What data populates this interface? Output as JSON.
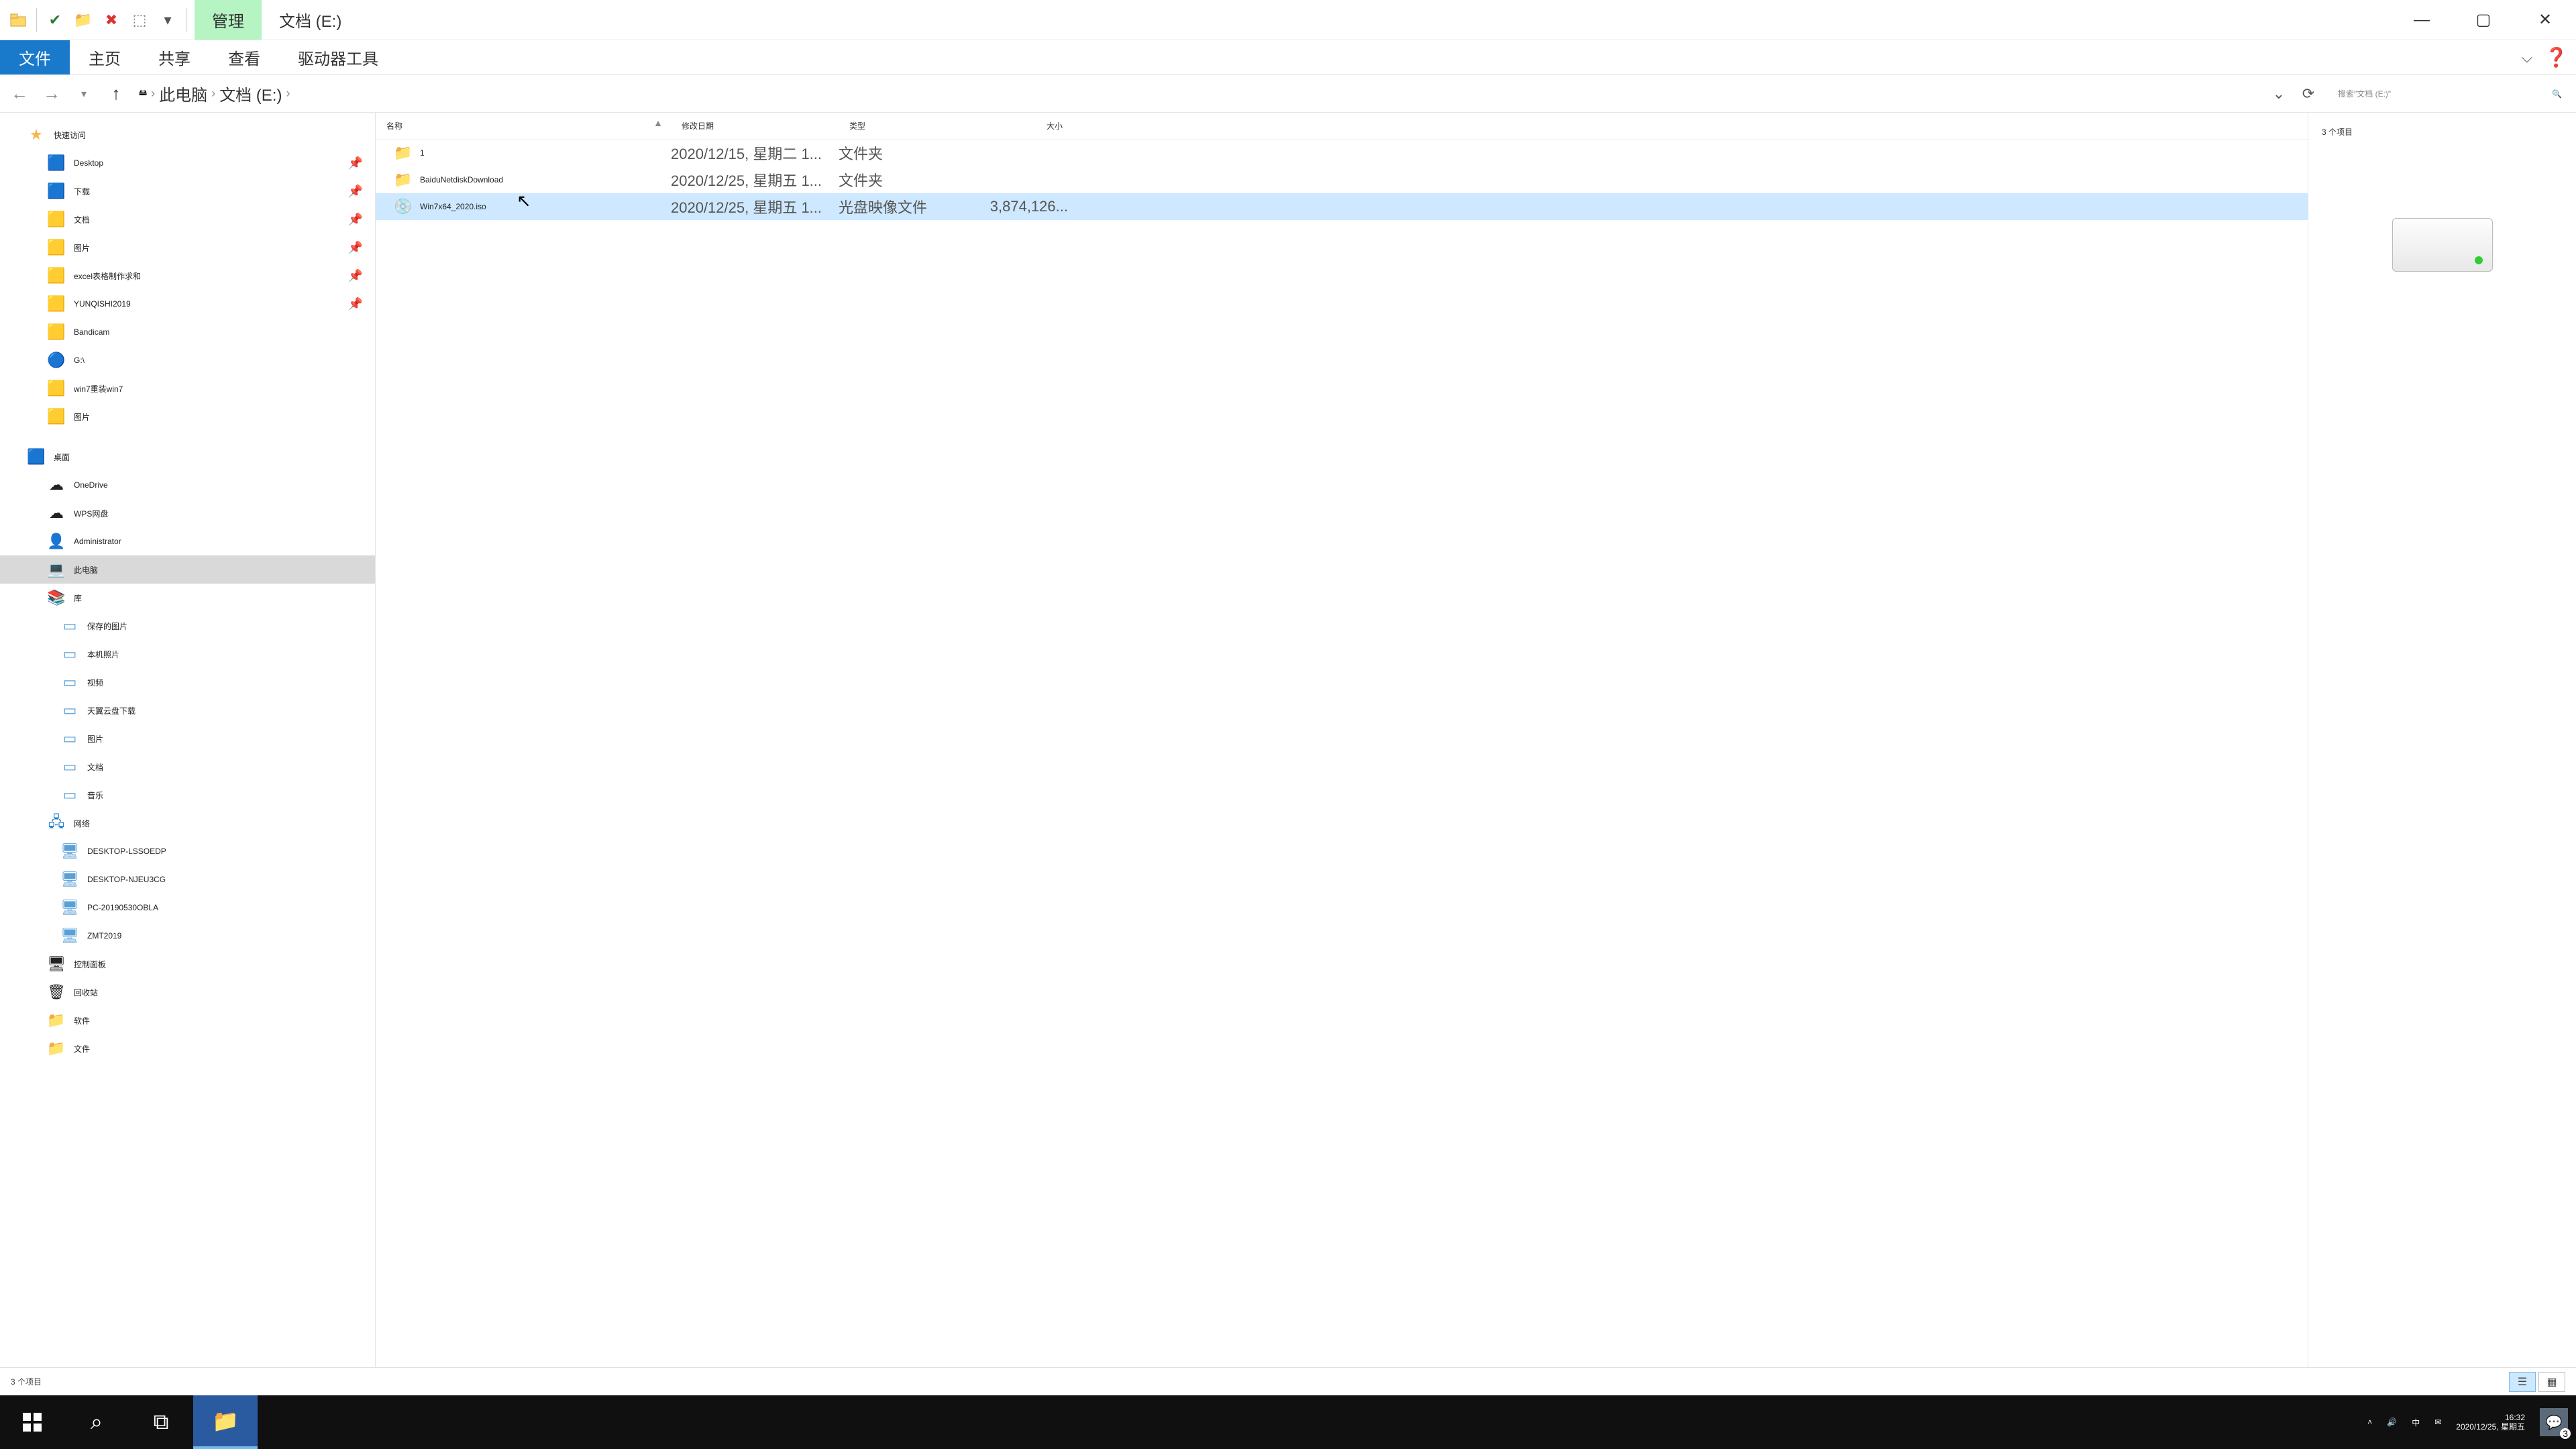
{
  "title": {
    "context_tab": "管理",
    "location_tab": "文档 (E:)"
  },
  "ribbon": {
    "file": "文件",
    "home": "主页",
    "share": "共享",
    "view": "查看",
    "drives": "驱动器工具"
  },
  "breadcrumb": {
    "root": "此电脑",
    "drive": "文档 (E:)"
  },
  "search": {
    "placeholder": "搜索\"文档 (E:)\""
  },
  "columns": {
    "name": "名称",
    "date": "修改日期",
    "type": "类型",
    "size": "大小"
  },
  "files": [
    {
      "icon": "folder",
      "name": "1",
      "date": "2020/12/15, 星期二 1...",
      "type": "文件夹",
      "size": "",
      "selected": false
    },
    {
      "icon": "folder",
      "name": "BaiduNetdiskDownload",
      "date": "2020/12/25, 星期五 1...",
      "type": "文件夹",
      "size": "",
      "selected": false
    },
    {
      "icon": "iso",
      "name": "Win7x64_2020.iso",
      "date": "2020/12/25, 星期五 1...",
      "type": "光盘映像文件",
      "size": "3,874,126...",
      "selected": true
    }
  ],
  "nav": {
    "quick": "快速访问",
    "quick_items": [
      {
        "label": "Desktop",
        "icon": "🟦",
        "pin": true
      },
      {
        "label": "下载",
        "icon": "🟦",
        "pin": true
      },
      {
        "label": "文档",
        "icon": "🟨",
        "pin": true
      },
      {
        "label": "图片",
        "icon": "🟨",
        "pin": true
      },
      {
        "label": "excel表格制作求和",
        "icon": "🟨",
        "pin": true
      },
      {
        "label": "YUNQISHI2019",
        "icon": "🟨",
        "pin": true
      },
      {
        "label": "Bandicam",
        "icon": "🟨",
        "pin": false
      },
      {
        "label": "G:\\",
        "icon": "🔵",
        "pin": false
      },
      {
        "label": "win7重装win7",
        "icon": "🟨",
        "pin": false
      },
      {
        "label": "图片",
        "icon": "🟨",
        "pin": false
      }
    ],
    "desktop": "桌面",
    "desktop_items": [
      {
        "label": "OneDrive",
        "icon": "☁"
      },
      {
        "label": "WPS网盘",
        "icon": "☁"
      },
      {
        "label": "Administrator",
        "icon": "👤"
      },
      {
        "label": "此电脑",
        "icon": "💻",
        "selected": true
      },
      {
        "label": "库",
        "icon": "📚"
      }
    ],
    "lib_items": [
      {
        "label": "保存的图片"
      },
      {
        "label": "本机照片"
      },
      {
        "label": "视频"
      },
      {
        "label": "天翼云盘下载"
      },
      {
        "label": "图片"
      },
      {
        "label": "文档"
      },
      {
        "label": "音乐"
      }
    ],
    "network": "网络",
    "net_items": [
      {
        "label": "DESKTOP-LSSOEDP"
      },
      {
        "label": "DESKTOP-NJEU3CG"
      },
      {
        "label": "PC-20190530OBLA"
      },
      {
        "label": "ZMT2019"
      }
    ],
    "extras": [
      {
        "label": "控制面板",
        "icon": "🖥"
      },
      {
        "label": "回收站",
        "icon": "🗑"
      },
      {
        "label": "软件",
        "icon": "📁"
      },
      {
        "label": "文件",
        "icon": "📁"
      }
    ]
  },
  "preview": {
    "count_label": "3 个项目"
  },
  "status": {
    "left": "3 个项目"
  },
  "tray": {
    "ime": "中",
    "time": "16:32",
    "date": "2020/12/25, 星期五",
    "notif_count": "3"
  }
}
